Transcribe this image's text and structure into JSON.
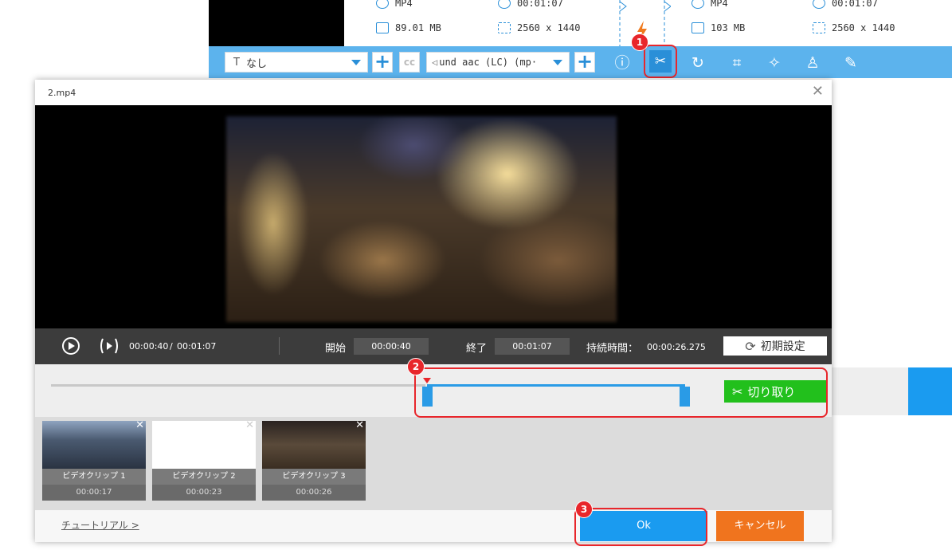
{
  "background_app": {
    "source": {
      "format": "MP4",
      "duration": "00:01:07",
      "size": "89.01 MB",
      "resolution": "2560 x 1440"
    },
    "output": {
      "format": "MP4",
      "duration": "00:01:07",
      "size": "103 MB",
      "resolution": "2560 x 1440"
    },
    "toolbar": {
      "subtitle_select": "なし",
      "audio_select": "und aac (LC) (mp·"
    }
  },
  "badges": [
    "1",
    "2",
    "3"
  ],
  "dialog": {
    "title": "2.mp4",
    "controls": {
      "current_time": "00:00:40",
      "separator": "/",
      "total_time": "00:01:07",
      "start_label": "開始",
      "start_value": "00:00:40",
      "end_label": "終了",
      "end_value": "00:01:07",
      "duration_label": "持続時間：",
      "duration_value": "00:00:26.275",
      "reset_label": "初期設定"
    },
    "cut_label": "切り取り",
    "clips": [
      {
        "label": "ビデオクリップ 1",
        "duration": "00:00:17"
      },
      {
        "label": "ビデオクリップ 2",
        "duration": "00:00:23"
      },
      {
        "label": "ビデオクリップ 3",
        "duration": "00:00:26"
      }
    ],
    "footer": {
      "tutorial": "チュートリアル >",
      "ok": "Ok",
      "cancel": "キャンセル"
    }
  },
  "colors": {
    "accent": "#2a9be6",
    "highlight": "#e8262b",
    "cut_green": "#22c01c",
    "cancel_orange": "#f0741e"
  }
}
